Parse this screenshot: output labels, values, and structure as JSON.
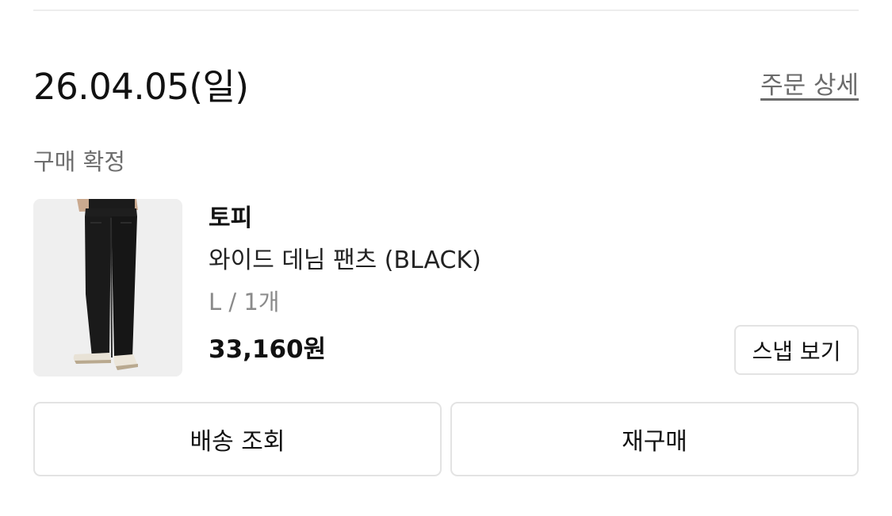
{
  "order": {
    "date": "26.04.05(일)",
    "detail_link": "주문 상세",
    "status": "구매 확정"
  },
  "product": {
    "image_icon": "denim-pants-photo",
    "brand": "토피",
    "name": "와이드 데님 팬츠 (BLACK)",
    "option": "L / 1개",
    "price": "33,160원",
    "snap_button": "스냅 보기"
  },
  "actions": {
    "delivery_button": "배송 조회",
    "rebuy_button": "재구매"
  },
  "colors": {
    "text_primary": "#111111",
    "text_secondary": "#6e6e6e",
    "text_muted": "#8a8a8a",
    "border": "#e3e3e3",
    "thumb_bg": "#efefef"
  }
}
